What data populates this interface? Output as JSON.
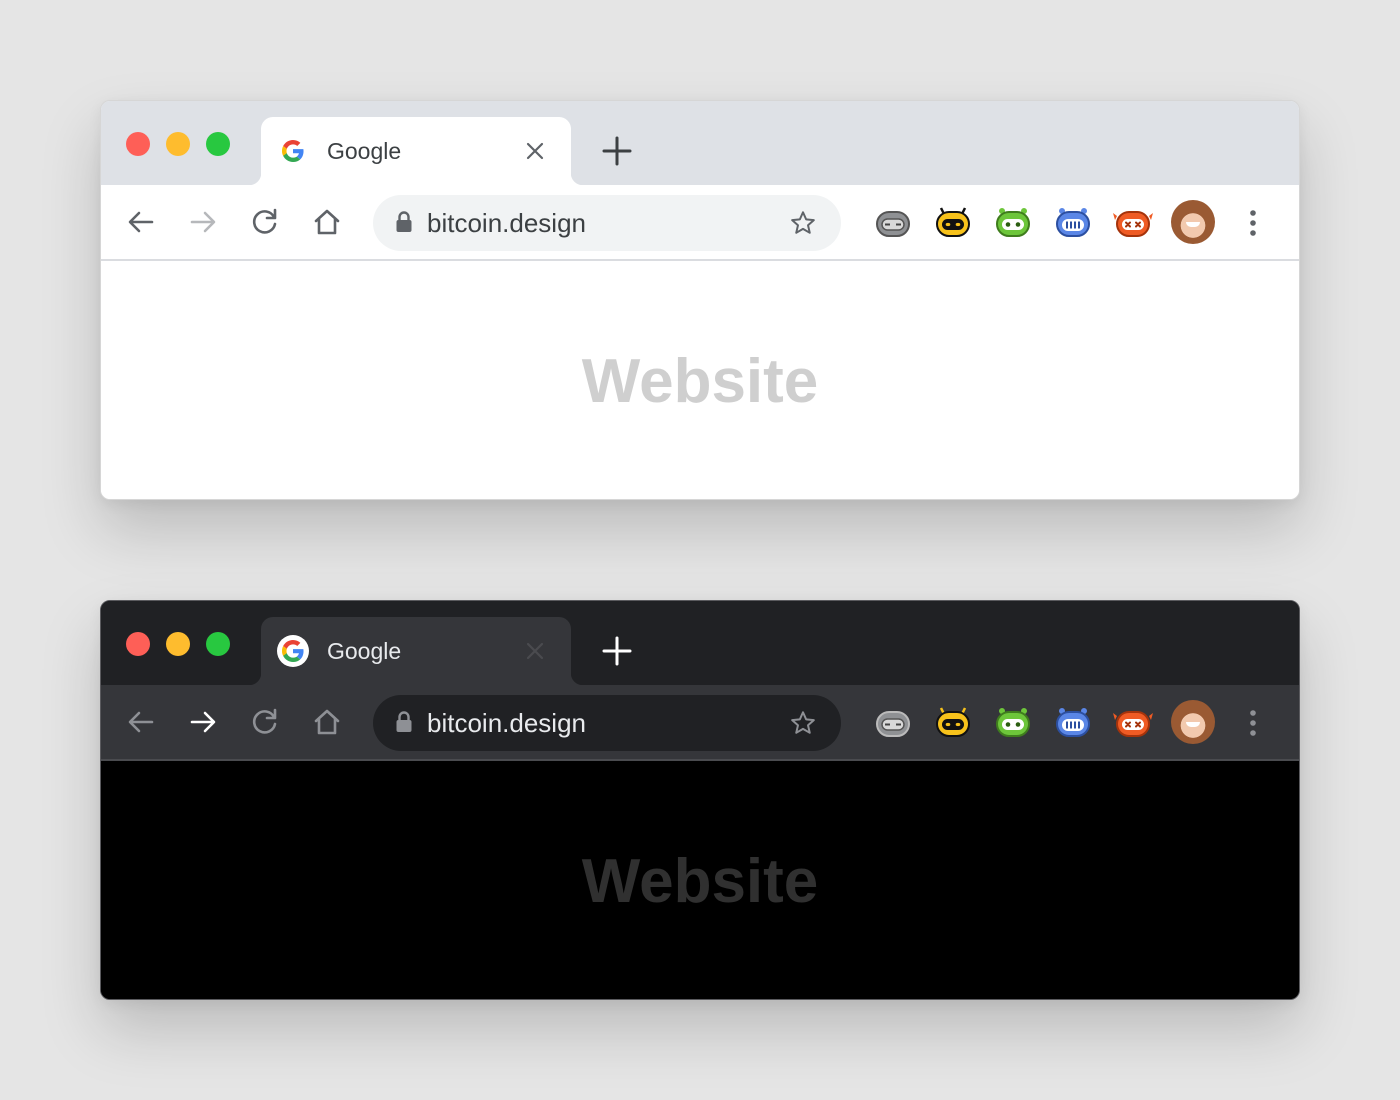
{
  "colors": {
    "page_background": "#e5e5e5",
    "traffic_red": "#fe5f57",
    "traffic_yellow": "#febc2e",
    "traffic_green": "#28c840",
    "extension_gray": "#8f9194",
    "extension_yellow": "#f7c21b",
    "extension_green": "#6dc63a",
    "extension_blue": "#5a86e6",
    "extension_orange": "#ef5b24"
  },
  "light": {
    "theme": "light",
    "tab": {
      "title": "Google",
      "favicon": "google-g-icon",
      "close_icon": "close-icon"
    },
    "new_tab_icon": "plus-icon",
    "toolbar": {
      "back_icon": "arrow-left-icon",
      "forward_icon": "arrow-right-icon",
      "reload_icon": "reload-icon",
      "home_icon": "home-icon",
      "omnibox": {
        "url": "bitcoin.design",
        "lock_icon": "lock-icon",
        "bookmark_icon": "star-icon"
      },
      "extensions": [
        "gray-robot-icon",
        "yellow-robot-icon",
        "green-robot-icon",
        "blue-robot-icon",
        "orange-robot-icon"
      ],
      "profile_icon": "profile-avatar",
      "menu_icon": "vertical-dots-icon"
    },
    "content": {
      "label": "Website"
    }
  },
  "dark": {
    "theme": "dark",
    "tab": {
      "title": "Google",
      "favicon": "google-g-icon",
      "close_icon": "close-icon"
    },
    "new_tab_icon": "plus-icon",
    "toolbar": {
      "back_icon": "arrow-left-icon",
      "forward_icon": "arrow-right-icon",
      "reload_icon": "reload-icon",
      "home_icon": "home-icon",
      "omnibox": {
        "url": "bitcoin.design",
        "lock_icon": "lock-icon",
        "bookmark_icon": "star-icon"
      },
      "extensions": [
        "gray-robot-icon",
        "yellow-robot-icon",
        "green-robot-icon",
        "blue-robot-icon",
        "orange-robot-icon"
      ],
      "profile_icon": "profile-avatar",
      "menu_icon": "vertical-dots-icon"
    },
    "content": {
      "label": "Website"
    }
  }
}
